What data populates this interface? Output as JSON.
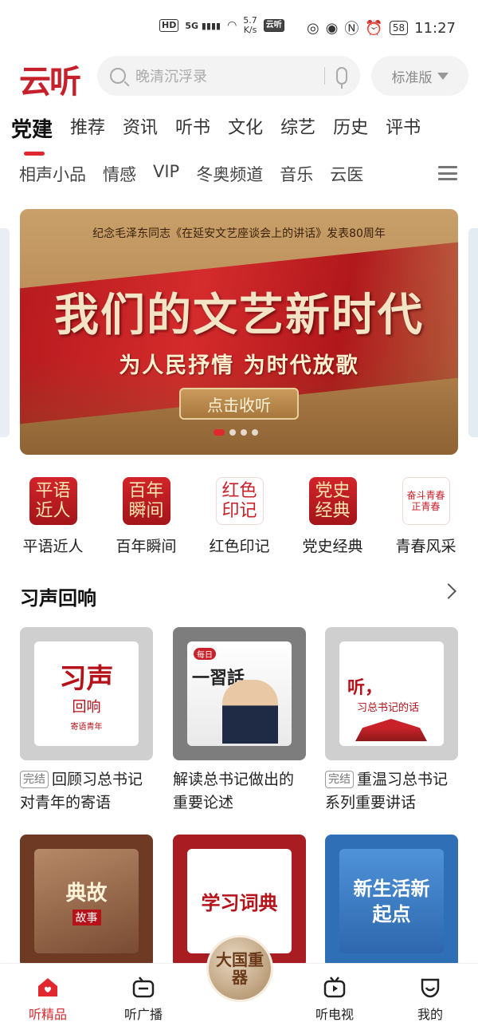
{
  "status_bar": {
    "left_badges": [
      "HD",
      "5G"
    ],
    "speed": "5.7\nK/s",
    "app_badge": "云听",
    "battery": "58",
    "time": "11:27"
  },
  "header": {
    "logo": "云听",
    "search_placeholder": "晚清沉浮录",
    "edition": "标准版"
  },
  "tabs_primary": [
    "党建",
    "推荐",
    "资讯",
    "听书",
    "文化",
    "综艺",
    "历史",
    "评书"
  ],
  "tabs_secondary": [
    "相声小品",
    "情感",
    "VIP",
    "冬奥频道",
    "音乐",
    "云医"
  ],
  "banner": {
    "top_line": "纪念毛泽东同志《在延安文艺座谈会上的讲话》发表80周年",
    "title": "我们的文艺新时代",
    "subtitle": "为人民抒情 为时代放歌",
    "button": "点击收听",
    "dots": 4
  },
  "quick_entries": [
    {
      "icon_text": "平语近人",
      "label": "平语近人"
    },
    {
      "icon_text": "百年瞬间",
      "label": "百年瞬间"
    },
    {
      "icon_text": "红色印记",
      "label": "红色印记"
    },
    {
      "icon_text": "党史经典",
      "label": "党史经典"
    },
    {
      "icon_text": "奋斗青春正青春",
      "label": "青春风采"
    }
  ],
  "section": {
    "title": "习声回响",
    "cards": [
      {
        "tag": "完结",
        "title": "回顾习总书记对青年的寄语",
        "art_main": "习声",
        "art_sub": "回响",
        "art_foot": "寄语青年"
      },
      {
        "tag": "",
        "title": "解读总书记做出的重要论述",
        "art_main": "一習話",
        "art_sub": "每日"
      },
      {
        "tag": "完结",
        "title": "重温习总书记系列重要讲话",
        "art_main": "听，",
        "art_sub": "习总书记的话"
      }
    ],
    "cards_row2": [
      {
        "art_main": "典故",
        "art_sub": "故事"
      },
      {
        "art_main": "学习词典"
      },
      {
        "art_main": "新生活新起点"
      }
    ]
  },
  "bottom_nav": {
    "items": [
      "听精品",
      "听广播",
      "大国重器",
      "听电视",
      "我的"
    ],
    "active": 0
  },
  "colors": {
    "accent": "#e0282e",
    "brand_red": "#c6212a"
  }
}
